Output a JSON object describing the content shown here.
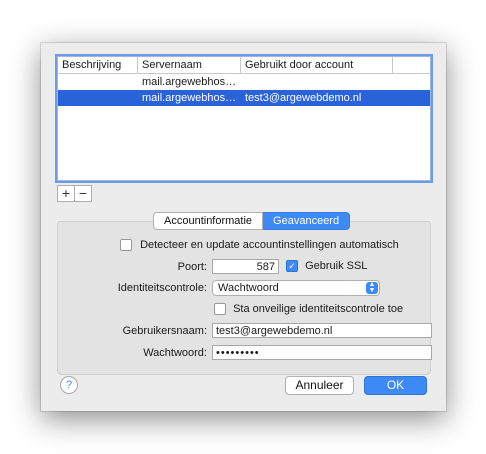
{
  "accounts_table": {
    "columns": [
      "Beschrijving",
      "Servernaam",
      "Gebruikt door account"
    ],
    "rows": [
      {
        "description": "",
        "server": "mail.argewebhosti...",
        "account": ""
      },
      {
        "description": "",
        "server": "mail.argewebhosti...",
        "account": "test3@argewebdemo.nl"
      }
    ]
  },
  "list_controls": {
    "add": "+",
    "remove": "−"
  },
  "tabs": [
    "Accountinformatie",
    "Geavanceerd"
  ],
  "advanced": {
    "detect_label": "Detecteer en update accountinstellingen automatisch",
    "port_label": "Poort:",
    "port_value": "587",
    "ssl_label": "Gebruik SSL",
    "auth_label": "Identiteitscontrole:",
    "auth_value": "Wachtwoord",
    "insecure_label": "Sta onveilige identiteitscontrole toe",
    "username_label": "Gebruikersnaam:",
    "username_value": "test3@argewebdemo.nl",
    "password_label": "Wachtwoord:",
    "password_value": "•••••••••"
  },
  "footer": {
    "help": "?",
    "cancel": "Annuleer",
    "ok": "OK"
  },
  "colors": {
    "accent": "#3d8af7",
    "selection": "#2a62d9"
  }
}
